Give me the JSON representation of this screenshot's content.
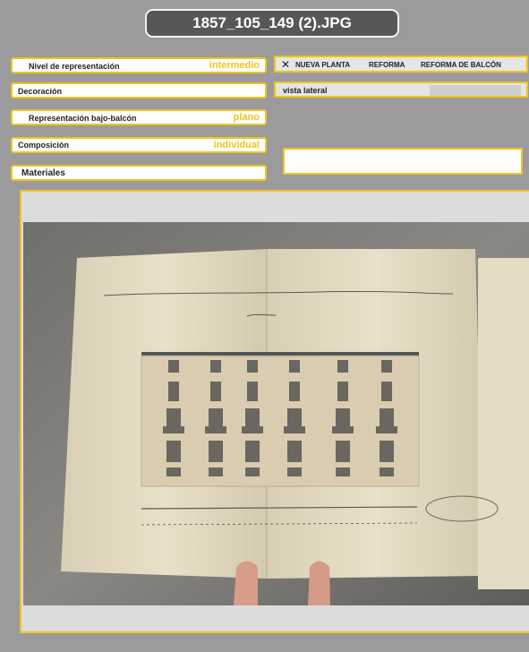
{
  "title": "1857_105_149 (2).JPG",
  "fields": {
    "nivel": {
      "label": "Nivel de representación",
      "value": "intermedio"
    },
    "decoracion": {
      "label": "Decoración",
      "value": ""
    },
    "representacion": {
      "label": "Representación bajo-balcón",
      "value": "plano"
    },
    "composicion": {
      "label": "Composición",
      "value": "individual"
    },
    "materiales": {
      "label": "Materiales",
      "value": ""
    }
  },
  "options": {
    "close_glyph": "✕",
    "items": [
      "NUEVA PLANTA",
      "REFORMA",
      "REFORMA DE  BALCÓN"
    ]
  },
  "vista": {
    "label": "vista lateral"
  },
  "colors": {
    "accent": "#f0c419",
    "background": "#9b9b9d",
    "title_bg": "#575757"
  }
}
